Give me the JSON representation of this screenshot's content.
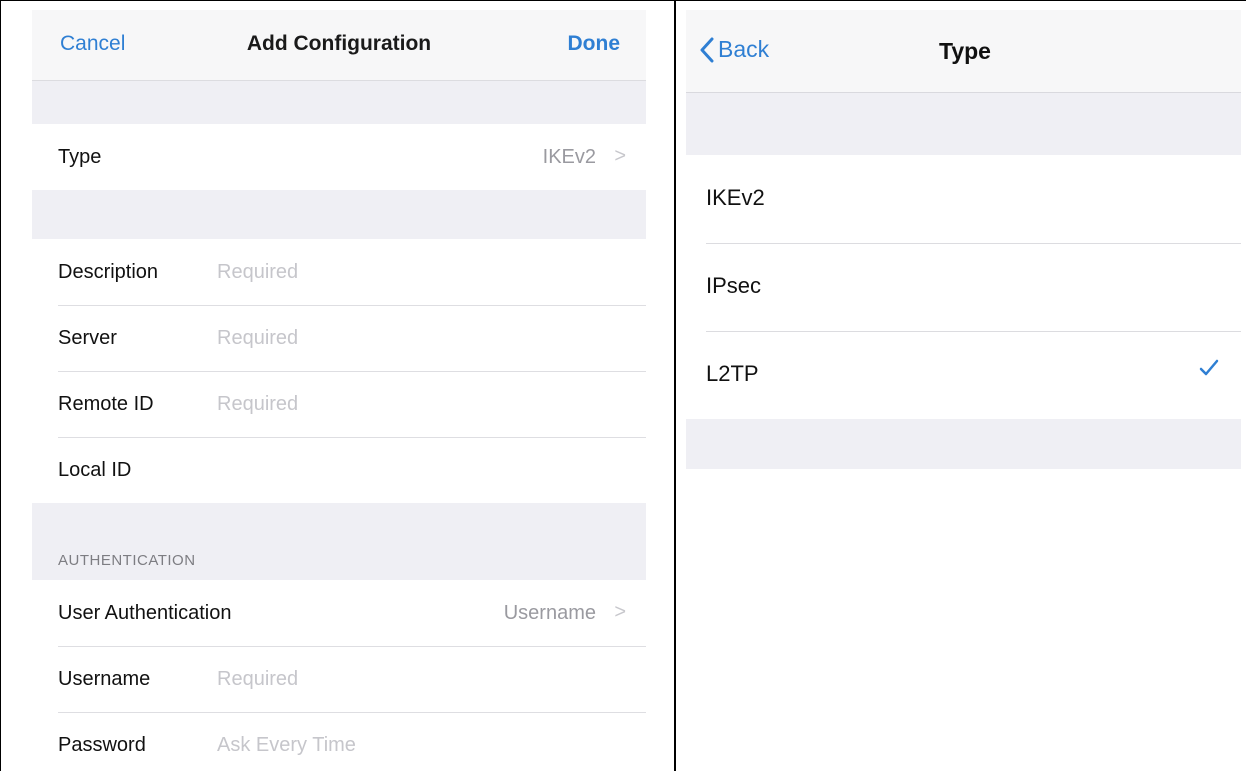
{
  "left": {
    "nav": {
      "cancel": "Cancel",
      "title": "Add Configuration",
      "done": "Done"
    },
    "type_row": {
      "label": "Type",
      "value": "IKEv2"
    },
    "fields": [
      {
        "label": "Description",
        "placeholder": "Required"
      },
      {
        "label": "Server",
        "placeholder": "Required"
      },
      {
        "label": "Remote ID",
        "placeholder": "Required"
      },
      {
        "label": "Local ID",
        "placeholder": ""
      }
    ],
    "auth_header": "AUTHENTICATION",
    "auth": {
      "user_auth": {
        "label": "User Authentication",
        "value": "Username"
      },
      "username": {
        "label": "Username",
        "placeholder": "Required"
      },
      "password": {
        "label": "Password",
        "placeholder": "Ask Every Time"
      }
    }
  },
  "right": {
    "nav": {
      "back": "Back",
      "title": "Type"
    },
    "options": [
      {
        "label": "IKEv2",
        "selected": false
      },
      {
        "label": "IPsec",
        "selected": false
      },
      {
        "label": "L2TP",
        "selected": true
      }
    ]
  },
  "colors": {
    "accent": "#2f7fd3",
    "group_bg": "#efeff4"
  },
  "icons": {
    "chevron": "chevron-right-icon",
    "back": "chevron-left-icon",
    "selected": "checkmark-icon"
  }
}
